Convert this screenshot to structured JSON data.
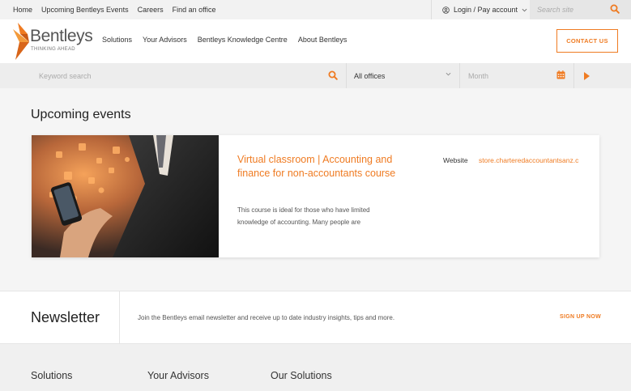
{
  "topbar": {
    "links": [
      "Home",
      "Upcoming Bentleys Events",
      "Careers",
      "Find an office"
    ],
    "login_label": "Login / Pay account",
    "search_placeholder": "Search site"
  },
  "header": {
    "brand": "Bentleys",
    "tagline": "THINKING AHEAD",
    "nav": [
      "Solutions",
      "Your Advisors",
      "Bentleys Knowledge Centre",
      "About Bentleys"
    ],
    "contact_label": "CONTACT US"
  },
  "filters": {
    "keyword_placeholder": "Keyword search",
    "office_value": "All offices",
    "month_placeholder": "Month"
  },
  "events": {
    "heading": "Upcoming events",
    "items": [
      {
        "title": "Virtual classroom | Accounting and finance for non-accountants course",
        "description": "This course is ideal for those who have limited knowledge of accounting. Many people are",
        "website_label": "Website",
        "website_link": "store.charteredaccountantsanz.c"
      }
    ]
  },
  "newsletter": {
    "title": "Newsletter",
    "text": "Join the Bentleys email newsletter and receive up to date industry insights, tips and more.",
    "signup_label": "SIGN UP NOW"
  },
  "footer": {
    "headings": [
      "Solutions",
      "Your Advisors",
      "Our Solutions"
    ]
  },
  "colors": {
    "accent": "#ef7b22",
    "text": "#333333",
    "background": "#f5f5f5"
  }
}
